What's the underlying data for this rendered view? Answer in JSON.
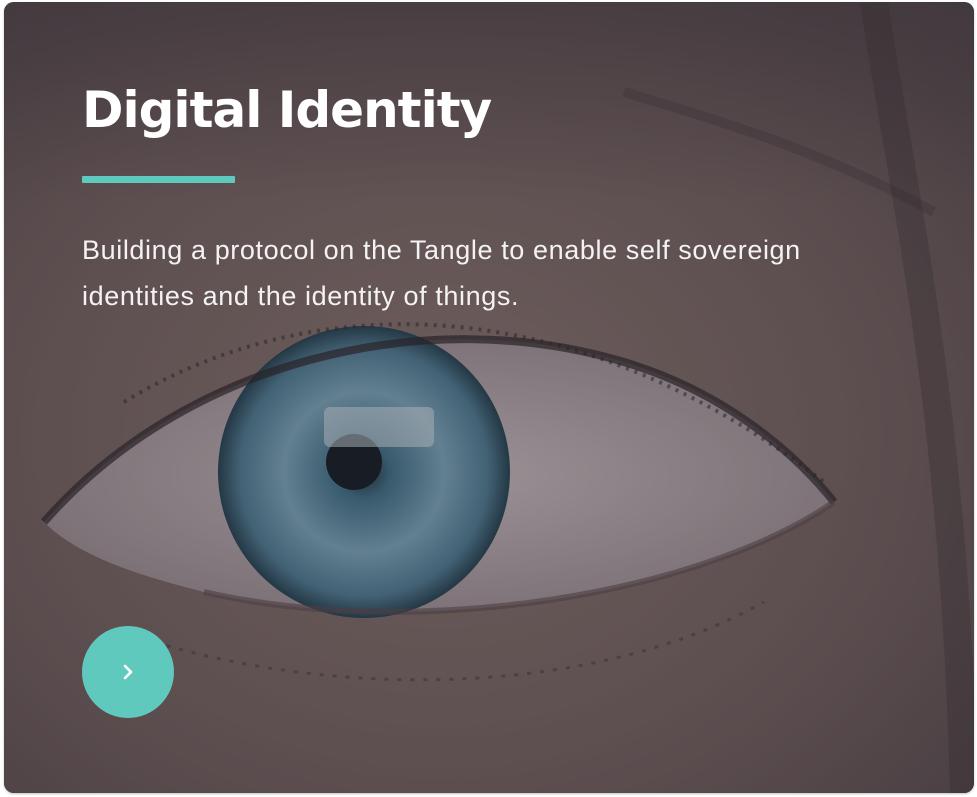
{
  "card": {
    "title": "Digital Identity",
    "description": "Building a protocol on the Tangle to enable self sovereign identities and the identity of things.",
    "background_image": "close-up-eye-photo",
    "accent_color": "#5fc9bd",
    "next_button_icon": "chevron-right-icon"
  }
}
